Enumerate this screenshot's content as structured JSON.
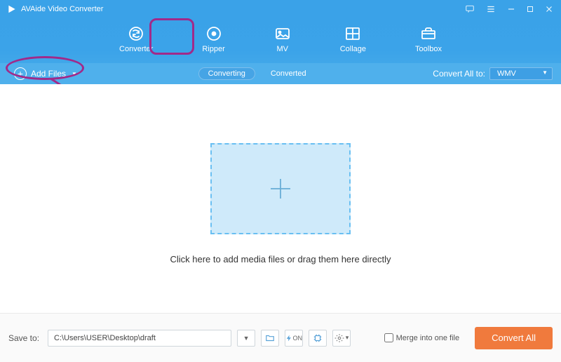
{
  "app": {
    "title": "AVAide Video Converter"
  },
  "tabs": [
    {
      "id": "converter",
      "label": "Converter"
    },
    {
      "id": "ripper",
      "label": "Ripper"
    },
    {
      "id": "mv",
      "label": "MV"
    },
    {
      "id": "collage",
      "label": "Collage"
    },
    {
      "id": "toolbox",
      "label": "Toolbox"
    }
  ],
  "subbar": {
    "add_files": "Add Files",
    "converting_label": "Converting",
    "converted_label": "Converted",
    "convert_all_to_label": "Convert All to:",
    "convert_all_to_value": "WMV"
  },
  "main": {
    "hint": "Click here to add media files or drag them here directly"
  },
  "footer": {
    "save_to_label": "Save to:",
    "save_to_path": "C:\\Users\\USER\\Desktop\\draft",
    "merge_label": "Merge into one file",
    "merge_checked": false,
    "convert_all_label": "Convert All"
  },
  "icons": {
    "feedback": "feedback-icon",
    "menu": "hamburger-icon",
    "minimize": "minimize-icon",
    "maximize": "maximize-icon",
    "close": "close-icon"
  },
  "annotations": {
    "highlight_converter": true,
    "highlight_addfiles": true,
    "arrow": true,
    "color": "#a12a8a"
  }
}
